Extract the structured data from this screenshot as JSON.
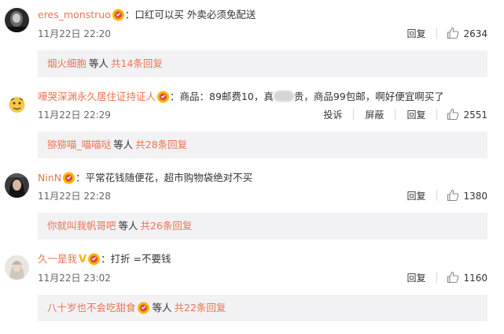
{
  "comments": [
    {
      "author": "eres_monstruo",
      "content": "：口红可以买  外卖必须免配送",
      "time": "11月22日 22:20",
      "actions": {
        "reply": "回复"
      },
      "likes": "2634",
      "replies": {
        "user": "烟火细胞",
        "etc": "等人",
        "count": "共14条回复"
      }
    },
    {
      "author": "嚎哭深渊永久居住证持证人",
      "content_a": "：商品：89邮费10，真",
      "content_b": "贵，商品99包邮，啊好便宜啊买了",
      "time": "11月22日 22:29",
      "actions": {
        "report": "投诉",
        "block": "屏蔽",
        "reply": "回复"
      },
      "likes": "2551",
      "replies": {
        "user": "猕猕喵_喵喵哒",
        "etc": "等人",
        "count": "共28条回复"
      }
    },
    {
      "author": "NinN",
      "content": "：平常花钱随便花，超市购物袋绝对不买",
      "time": "11月22日 22:28",
      "actions": {
        "reply": "回复"
      },
      "likes": "1380",
      "replies": {
        "user": "你就叫我帆哥吧",
        "etc": "等人",
        "count": "共26条回复"
      }
    },
    {
      "author": "久一是我",
      "content": "：打折  =不要钱",
      "time": "11月22日 23:02",
      "actions": {
        "reply": "回复"
      },
      "likes": "1160",
      "replies": {
        "user": "八十岁也不会吃甜食",
        "etc": "等人",
        "count": "共22条回复"
      }
    }
  ],
  "colors": {
    "accent": "#eb7350",
    "reply_bg": "#f2f2f5",
    "badge": "#f7b500",
    "vip": "#f7b500"
  },
  "icons": {
    "badge": "gold-badge-icon",
    "like": "thumbs-up-icon",
    "vip": "vip-v-icon"
  }
}
